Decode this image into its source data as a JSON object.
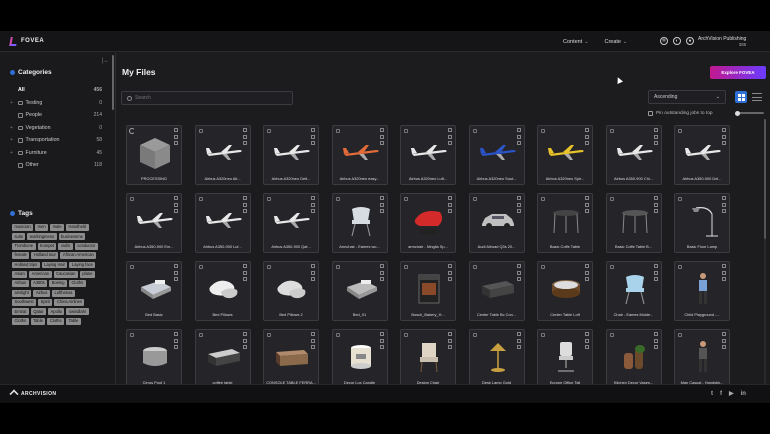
{
  "app": {
    "brand": "FOVEA"
  },
  "nav": {
    "content": "Content",
    "create": "Create"
  },
  "account": {
    "name": "ArchVision Publishing",
    "credits": "385"
  },
  "sidebar": {
    "categories_title": "Categories",
    "categories": [
      {
        "label": "All",
        "count": "456"
      },
      {
        "label": "Testing",
        "count": "0"
      },
      {
        "label": "People",
        "count": "214"
      },
      {
        "label": "Vegetation",
        "count": "0"
      },
      {
        "label": "Transportation",
        "count": "58"
      },
      {
        "label": "Furniture",
        "count": "45"
      },
      {
        "label": "Other",
        "count": "118"
      }
    ],
    "tags_title": "Tags",
    "tags": [
      "musician",
      "men",
      "male",
      "Handheld",
      "suits",
      "workingmens",
      "businessme",
      "Trombone",
      "trumpet",
      "violin",
      "conductor",
      "female",
      "Holland tour",
      "African American",
      "Holland trips",
      "Laying Hair",
      "Laying face",
      "Asian",
      "American",
      "Caucasian",
      "plane",
      "Airbus",
      "A380s",
      "Boeing",
      "Cloths",
      "airstight",
      "Airbus",
      "Lufthansa",
      "Southwest",
      "Spirit",
      "China Airlines",
      "Emirat",
      "Qatar",
      "Apollo",
      "swindlahr",
      "Cloths",
      "Table",
      "Cloths",
      "Table"
    ]
  },
  "main": {
    "title": "My Files",
    "explore_label": "Explore FOVEA",
    "search_placeholder": "Search",
    "sort_value": "Ascending",
    "pin_label": "Pin outstanding jobs to top"
  },
  "files": [
    {
      "label": "PROCESSING",
      "kind": "cube"
    },
    {
      "label": "Airbus A320neo Alt...",
      "kind": "plane",
      "color": "#e8e8e8"
    },
    {
      "label": "Airbus A320neo Delt...",
      "kind": "plane",
      "color": "#e8e8e8"
    },
    {
      "label": "Airbus A320neo easy...",
      "kind": "plane",
      "color": "#e26b3a"
    },
    {
      "label": "Airbus A320neo Luft...",
      "kind": "plane",
      "color": "#e8e8e8"
    },
    {
      "label": "Airbus A320neo Sout...",
      "kind": "plane",
      "color": "#2a54c8"
    },
    {
      "label": "Airbus A320neo Spir...",
      "kind": "plane",
      "color": "#e8c22a"
    },
    {
      "label": "Airbus A350-900 Chi...",
      "kind": "plane",
      "color": "#e8e8e8"
    },
    {
      "label": "Airbus A350-900 Del...",
      "kind": "plane",
      "color": "#e8e8e8"
    },
    {
      "label": "Airbus A350-900 Em...",
      "kind": "plane",
      "color": "#e8e8e8"
    },
    {
      "label": "Airbus A350-900 Luf...",
      "kind": "plane",
      "color": "#e8e8e8"
    },
    {
      "label": "Airbus A350-900 Qat...",
      "kind": "plane",
      "color": "#e8e8e8"
    },
    {
      "label": "Armchair - Eames wo...",
      "kind": "chair",
      "color": "#d6dce2"
    },
    {
      "label": "armchair - Ninglia Sp...",
      "kind": "redchair",
      "color": "#d42a2a"
    },
    {
      "label": "Audi Allroad Q3s 20...",
      "kind": "car",
      "color": "#c0c0c0"
    },
    {
      "label": "Basic Coffe Table",
      "kind": "table",
      "color": "#444"
    },
    {
      "label": "Basic Coffe Table B...",
      "kind": "table",
      "color": "#555"
    },
    {
      "label": "Basic Floor Lamp",
      "kind": "lamp",
      "color": "#ddd"
    },
    {
      "label": "Bed Basic",
      "kind": "bed",
      "color": "#c8ccd4"
    },
    {
      "label": "Bed Pillows",
      "kind": "pillow",
      "color": "#eee"
    },
    {
      "label": "Bed Pillows 2",
      "kind": "pillow",
      "color": "#ddd"
    },
    {
      "label": "Bed_01",
      "kind": "bed",
      "color": "#bbb"
    },
    {
      "label": "Bosch_Bakery_H...",
      "kind": "oven",
      "color": "#333"
    },
    {
      "label": "Center Table Bc Con...",
      "kind": "cabinet",
      "color": "#555"
    },
    {
      "label": "Center Table Loft",
      "kind": "round",
      "color": "#8a6a4a"
    },
    {
      "label": "Chair - Eames Molde...",
      "kind": "chair",
      "color": "#a9d3ea"
    },
    {
      "label": "Child Playground -...",
      "kind": "person",
      "color": "#7aa0d8"
    },
    {
      "label": "Cirrus Pouf 1",
      "kind": "pouf",
      "color": "#bbb"
    },
    {
      "label": "coffee table",
      "kind": "cabinet",
      "color": "#ccc"
    },
    {
      "label": "CONSOLE TABLE FERRA...",
      "kind": "console",
      "color": "#8a6a4a"
    },
    {
      "label": "Decor Lux Candle",
      "kind": "candle",
      "color": "#e8e0d0"
    },
    {
      "label": "Design Chair",
      "kind": "armchair",
      "color": "#e0d4c4"
    },
    {
      "label": "Desk Lamp Gold",
      "kind": "desklamp",
      "color": "#c8a040"
    },
    {
      "label": "Europe Office Tall",
      "kind": "office",
      "color": "#ddd"
    },
    {
      "label": "Kitchen Decor Vases...",
      "kind": "vases",
      "color": "#8a5a3a"
    },
    {
      "label": "Man Casual - Handsbk...",
      "kind": "person",
      "color": "#555"
    }
  ]
}
